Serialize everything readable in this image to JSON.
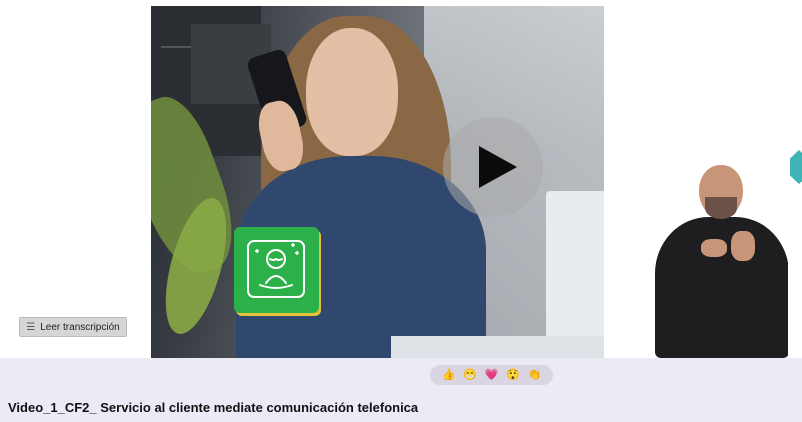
{
  "video": {
    "play_label": "Play"
  },
  "transcript_button": {
    "label": "Leer transcripción",
    "icon": "lines-icon"
  },
  "reactions": [
    {
      "name": "thumbs-up-icon",
      "glyph": "👍"
    },
    {
      "name": "grinning-face-icon",
      "glyph": "😁"
    },
    {
      "name": "heart-icon",
      "glyph": "💗"
    },
    {
      "name": "surprised-face-icon",
      "glyph": "😲"
    },
    {
      "name": "clapping-hands-icon",
      "glyph": "👏"
    }
  ],
  "video_title": "Video_1_CF2_ Servicio al cliente mediate comunicación telefonica",
  "colors": {
    "badge_green": "#2cb04a",
    "bar_background": "#eceaf4"
  }
}
